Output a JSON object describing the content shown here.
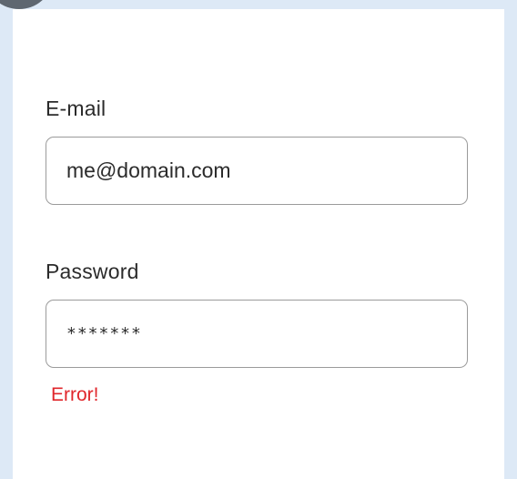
{
  "form": {
    "email": {
      "label": "E-mail",
      "value": "me@domain.com"
    },
    "password": {
      "label": "Password",
      "value": "*******"
    },
    "error": "Error!"
  },
  "colors": {
    "backdrop": "#dde9f6",
    "card": "#ffffff",
    "text": "#2b2b2b",
    "input_border": "#9b9b9b",
    "error": "#e0262b",
    "corner_circle": "#5f6770"
  }
}
